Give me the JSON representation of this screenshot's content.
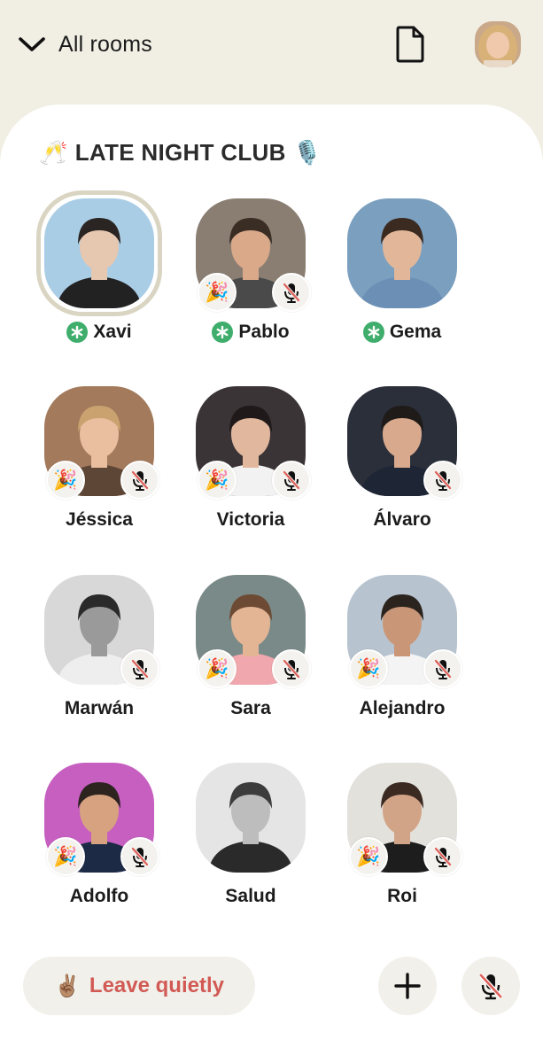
{
  "header": {
    "back_label": "All rooms"
  },
  "room": {
    "title": "LATE NIGHT CLUB",
    "title_emoji_left": "🥂",
    "title_emoji_right": "🎙️"
  },
  "speakers": [
    {
      "name": "Xavi",
      "moderator": true,
      "speaking": true,
      "party": false,
      "muted": false,
      "bg": "#aacde6",
      "skin": "#e6c7b0",
      "hair": "#2a2522",
      "shirt": "#222222"
    },
    {
      "name": "Pablo",
      "moderator": true,
      "speaking": false,
      "party": true,
      "muted": true,
      "bg": "#8a7e72",
      "skin": "#d9a98a",
      "hair": "#3a2d24",
      "shirt": "#4a4a4a"
    },
    {
      "name": "Gema",
      "moderator": true,
      "speaking": false,
      "party": false,
      "muted": false,
      "bg": "#7b9fbf",
      "skin": "#e2b799",
      "hair": "#3b2a20",
      "shirt": "#6c8fb5"
    },
    {
      "name": "Jéssica",
      "moderator": false,
      "speaking": false,
      "party": true,
      "muted": true,
      "bg": "#a37a5c",
      "skin": "#e9bfa0",
      "hair": "#caa270",
      "shirt": "#5d4636"
    },
    {
      "name": "Victoria",
      "moderator": false,
      "speaking": false,
      "party": true,
      "muted": true,
      "bg": "#3b3437",
      "skin": "#e1b79e",
      "hair": "#1f1919",
      "shirt": "#f2f2f2"
    },
    {
      "name": "Álvaro",
      "moderator": false,
      "speaking": false,
      "party": false,
      "muted": true,
      "bg": "#2b2f3a",
      "skin": "#d8a98c",
      "hair": "#1e1b19",
      "shirt": "#1e2535"
    },
    {
      "name": "Marwán",
      "moderator": false,
      "speaking": false,
      "party": false,
      "muted": true,
      "bg": "#d8d8d8",
      "skin": "#9a9a9a",
      "hair": "#2a2a2a",
      "shirt": "#eeeeee"
    },
    {
      "name": "Sara",
      "moderator": false,
      "speaking": false,
      "party": true,
      "muted": true,
      "bg": "#7a8a88",
      "skin": "#e3b595",
      "hair": "#6d4a33",
      "shirt": "#f0a7ad"
    },
    {
      "name": "Alejandro",
      "moderator": false,
      "speaking": false,
      "party": true,
      "muted": true,
      "bg": "#b7c3cf",
      "skin": "#c99778",
      "hair": "#2b241e",
      "shirt": "#f4f4f4"
    },
    {
      "name": "Adolfo",
      "moderator": false,
      "speaking": false,
      "party": true,
      "muted": true,
      "bg": "#c65fc0",
      "skin": "#d7a27f",
      "hair": "#2d2420",
      "shirt": "#1c2a45"
    },
    {
      "name": "Salud",
      "moderator": false,
      "speaking": false,
      "party": false,
      "muted": false,
      "bg": "#e5e5e5",
      "skin": "#bdbdbd",
      "hair": "#3c3c3c",
      "shirt": "#2a2a2a"
    },
    {
      "name": "Roi",
      "moderator": false,
      "speaking": false,
      "party": true,
      "muted": true,
      "bg": "#e3e1dc",
      "skin": "#d2a487",
      "hair": "#3b2a22",
      "shirt": "#1d1d1d"
    }
  ],
  "bottom": {
    "leave_emoji": "✌🏽",
    "leave_label": "Leave quietly"
  },
  "icons": {
    "back": "chevron-down-icon",
    "document": "document-icon",
    "party": "party-popper-icon",
    "mute": "mic-muted-icon",
    "moderator": "moderator-asterisk-icon",
    "add": "plus-icon"
  },
  "colors": {
    "header_bg": "#f1efe4",
    "moderator_green": "#3fad6c",
    "leave_red": "#d25a55",
    "muted_red": "#e0605a",
    "speaking_ring": "#d9d5c2"
  }
}
